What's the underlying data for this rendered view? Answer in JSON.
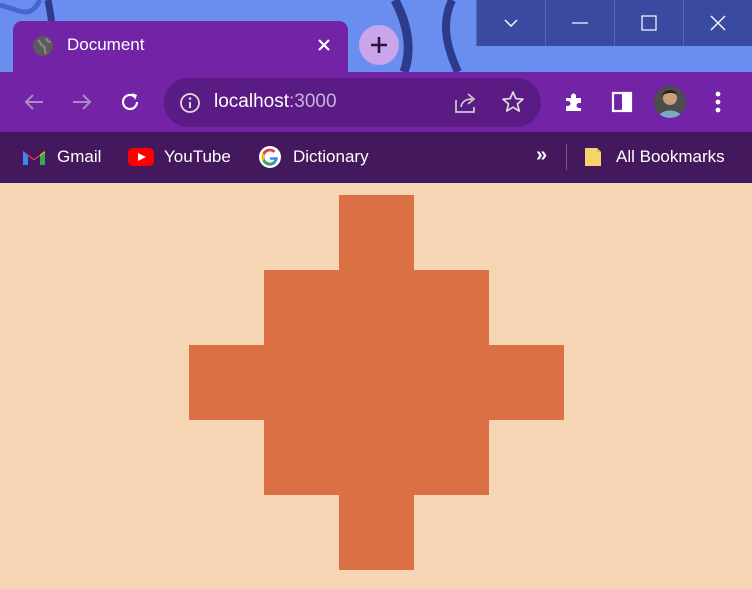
{
  "window": {
    "controls": [
      "chevron-down-icon",
      "minimize-icon",
      "maximize-icon",
      "close-icon"
    ]
  },
  "tab": {
    "title": "Document",
    "favicon": "globe-icon"
  },
  "toolbar": {
    "url_host": "localhost",
    "url_port": ":3000"
  },
  "bookmarks": {
    "items": [
      {
        "label": "Gmail",
        "icon": "gmail-icon"
      },
      {
        "label": "YouTube",
        "icon": "youtube-icon"
      },
      {
        "label": "Dictionary",
        "icon": "google-icon"
      }
    ],
    "overflow": "»",
    "all_bookmarks": "All Bookmarks"
  },
  "page": {
    "background": "#f5d5b3",
    "shape_color": "#db7044",
    "grid_rows": [
      [
        0,
        0,
        1,
        0,
        0
      ],
      [
        0,
        1,
        1,
        1,
        0
      ],
      [
        1,
        1,
        1,
        1,
        1
      ],
      [
        0,
        1,
        1,
        1,
        0
      ],
      [
        0,
        0,
        1,
        0,
        0
      ]
    ]
  }
}
